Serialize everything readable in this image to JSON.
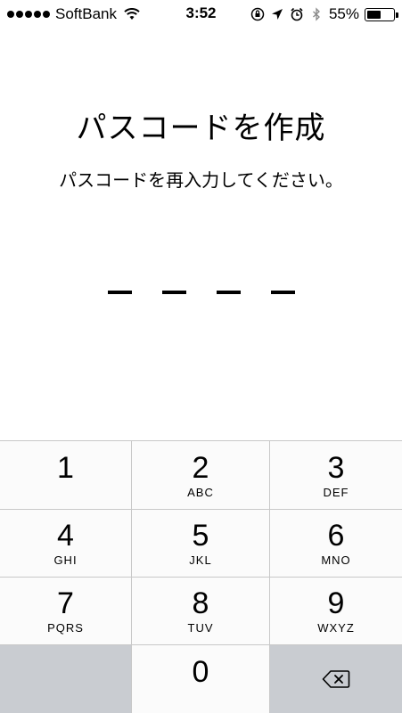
{
  "status_bar": {
    "carrier": "SoftBank",
    "signal_dots": 5,
    "time": "3:52",
    "battery_percent": "55%",
    "battery_level": 0.55,
    "icons": [
      "wifi-icon",
      "orientation-lock-icon",
      "location-arrow-icon",
      "alarm-icon",
      "bluetooth-icon",
      "battery-icon"
    ]
  },
  "header": {
    "title": "パスコードを作成",
    "subtitle": "パスコードを再入力してください。"
  },
  "passcode": {
    "length": 4,
    "entered": 0
  },
  "keypad": {
    "keys": [
      {
        "digit": "1",
        "letters": ""
      },
      {
        "digit": "2",
        "letters": "ABC"
      },
      {
        "digit": "3",
        "letters": "DEF"
      },
      {
        "digit": "4",
        "letters": "GHI"
      },
      {
        "digit": "5",
        "letters": "JKL"
      },
      {
        "digit": "6",
        "letters": "MNO"
      },
      {
        "digit": "7",
        "letters": "PQRS"
      },
      {
        "digit": "8",
        "letters": "TUV"
      },
      {
        "digit": "9",
        "letters": "WXYZ"
      },
      {
        "digit": "0",
        "letters": ""
      }
    ],
    "delete_icon": "backspace-icon"
  }
}
